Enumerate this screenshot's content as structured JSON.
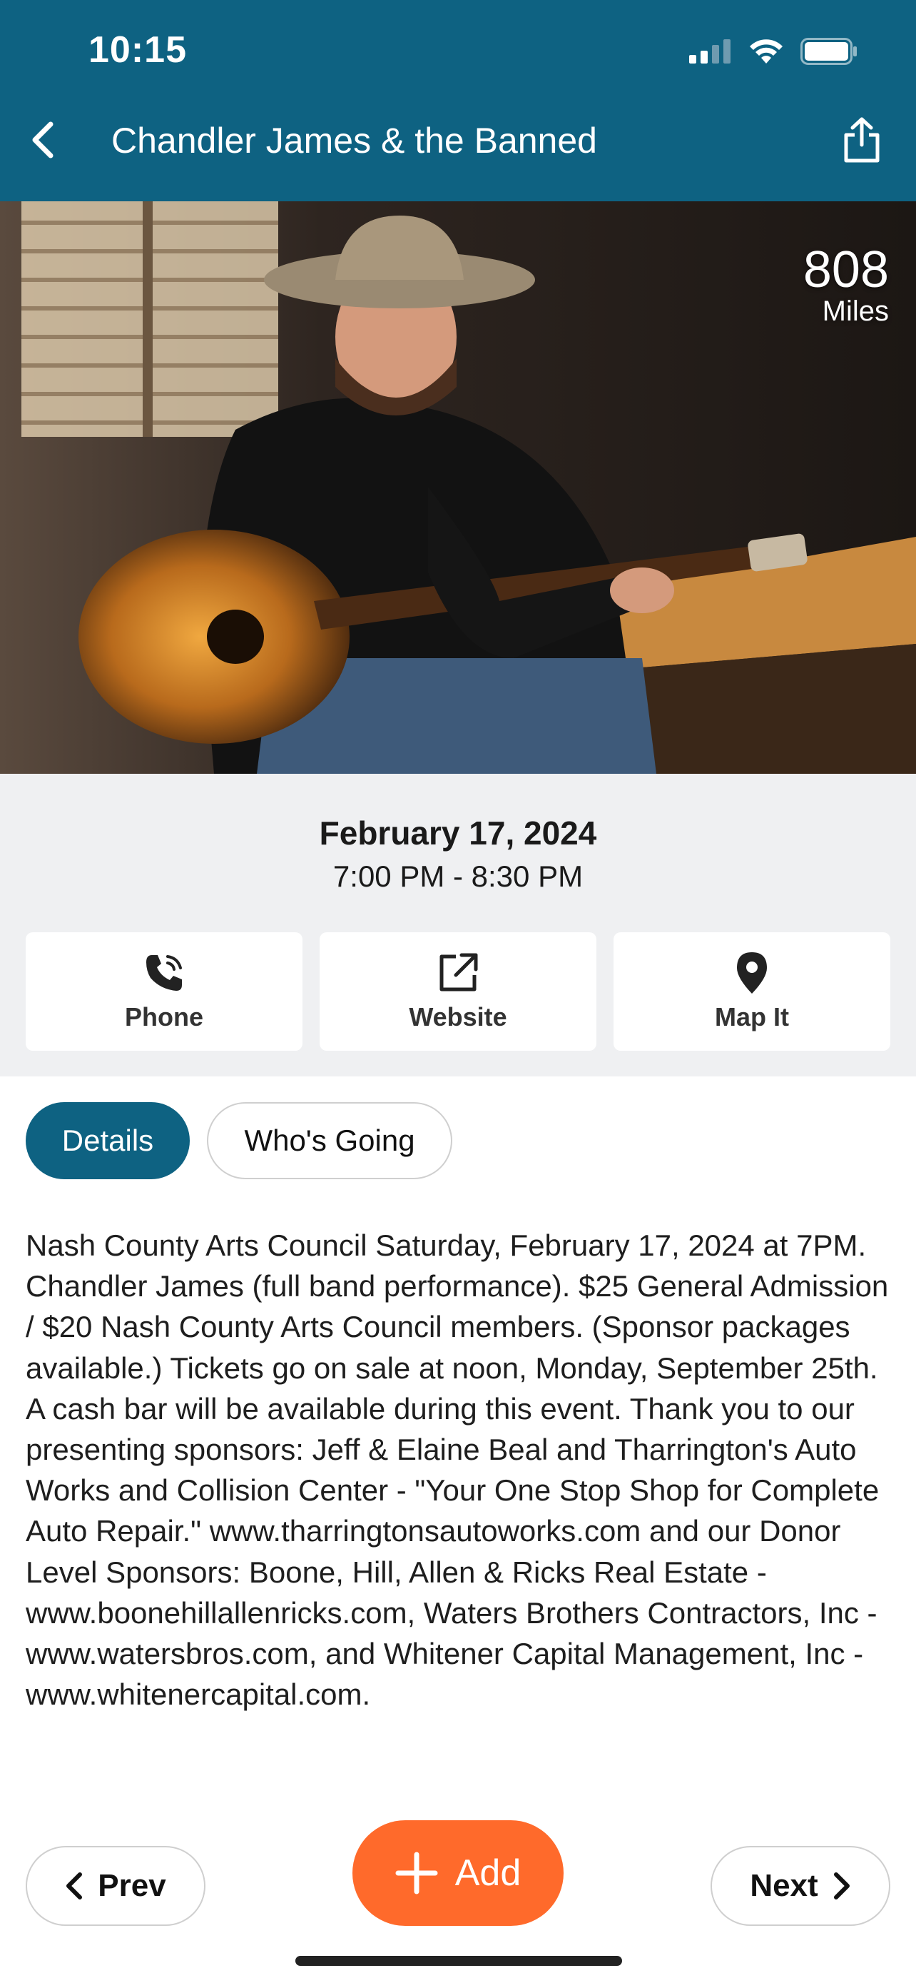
{
  "status_bar": {
    "time": "10:15"
  },
  "header": {
    "title": "Chandler James & the Banned"
  },
  "hero": {
    "distance_value": "808",
    "distance_unit": "Miles"
  },
  "event": {
    "date": "February 17, 2024",
    "time": "7:00 PM - 8:30 PM"
  },
  "actions": [
    {
      "label": "Phone",
      "icon": "phone-icon"
    },
    {
      "label": "Website",
      "icon": "external-link-icon"
    },
    {
      "label": "Map It",
      "icon": "map-pin-icon"
    }
  ],
  "tabs": [
    {
      "label": "Details",
      "active": true
    },
    {
      "label": "Who's Going",
      "active": false
    }
  ],
  "description": "Nash County Arts Council Saturday, February 17, 2024 at 7PM. Chandler James (full band performance). $25 General Admission / $20 Nash County Arts Council members. (Sponsor packages available.) Tickets go on sale at noon, Monday, September 25th. A cash bar will be available during this event. Thank you to our presenting sponsors: Jeff & Elaine Beal and Tharrington's Auto Works and Collision Center - \"Your One Stop Shop for Complete Auto Repair.\" www.tharringtonsautoworks.com and our Donor Level Sponsors: Boone, Hill, Allen & Ricks Real Estate - www.boonehillallenricks.com, Waters Brothers Contractors, Inc - www.watersbros.com, and Whitener Capital Management, Inc - www.whitenercapital.com.",
  "footer": {
    "prev_label": "Prev",
    "add_label": "Add",
    "next_label": "Next"
  },
  "colors": {
    "primary": "#0e6282",
    "accent": "#ff6a2b",
    "panel": "#eff0f2"
  }
}
